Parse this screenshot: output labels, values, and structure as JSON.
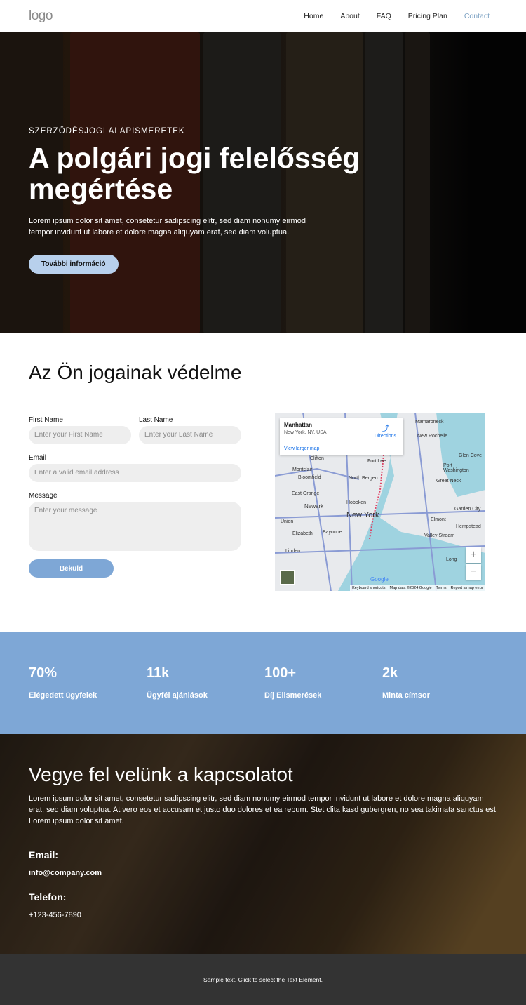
{
  "header": {
    "logo": "logo",
    "nav": [
      "Home",
      "About",
      "FAQ",
      "Pricing Plan",
      "Contact"
    ],
    "active": "Contact"
  },
  "hero": {
    "eyebrow": "SZERZŐDÉSJOGI ALAPISMERETEK",
    "title": "A polgári jogi felelősség megértése",
    "text": "Lorem ipsum dolor sit amet, consetetur sadipscing elitr, sed diam nonumy eirmod tempor invidunt ut labore et dolore magna aliquyam erat, sed diam voluptua.",
    "button": "További információ"
  },
  "form_section": {
    "title": "Az Ön jogainak védelme",
    "first_name": {
      "label": "First Name",
      "placeholder": "Enter your First Name"
    },
    "last_name": {
      "label": "Last Name",
      "placeholder": "Enter your Last Name"
    },
    "email": {
      "label": "Email",
      "placeholder": "Enter a valid email address"
    },
    "message": {
      "label": "Message",
      "placeholder": "Enter your message"
    },
    "submit": "Beküld"
  },
  "map": {
    "place": "Manhattan",
    "address": "New York, NY, USA",
    "directions": "Directions",
    "larger": "View larger map",
    "labels": [
      "Mamaroneck",
      "New Rochelle",
      "Clifton",
      "Fort Lee",
      "Glen Cove",
      "Montclair",
      "Bloomfield",
      "North Bergen",
      "Port Washington",
      "Great Neck",
      "East Orange",
      "Hoboken",
      "Newark",
      "New York",
      "Garden City",
      "Union",
      "Elmont",
      "Hempstead",
      "Elizabeth",
      "Bayonne",
      "Valley Stream",
      "Linden",
      "Long"
    ],
    "attribution": [
      "Keyboard shortcuts",
      "Map data ©2024 Google",
      "Terms",
      "Report a map error"
    ],
    "google": "Google",
    "zoom_in": "+",
    "zoom_out": "−"
  },
  "stats": [
    {
      "value": "70%",
      "label": "Elégedett ügyfelek"
    },
    {
      "value": "11k",
      "label": "Ügyfél ajánlások"
    },
    {
      "value": "100+",
      "label": "Díj Elismerések"
    },
    {
      "value": "2k",
      "label": "Minta címsor"
    }
  ],
  "contact": {
    "title": "Vegye fel velünk a kapcsolatot",
    "text": "Lorem ipsum dolor sit amet, consetetur sadipscing elitr, sed diam nonumy eirmod tempor invidunt ut labore et dolore magna aliquyam erat, sed diam voluptua. At vero eos et accusam et justo duo dolores et ea rebum. Stet clita kasd gubergren, no sea takimata sanctus est Lorem ipsum dolor sit amet.",
    "email_label": "Email:",
    "email": "info@company.com",
    "phone_label": "Telefon:",
    "phone": "+123-456-7890"
  },
  "footer": {
    "text": "Sample text. Click to select the Text Element."
  }
}
